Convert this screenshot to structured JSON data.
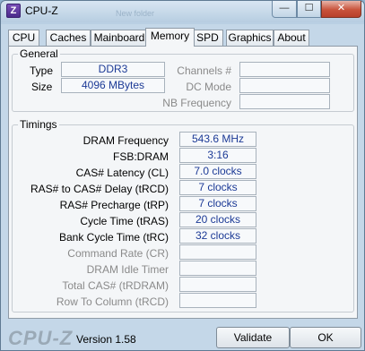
{
  "window": {
    "title": "CPU-Z",
    "app_icon_glyph": "Z",
    "background_text": "New folder"
  },
  "caption": {
    "minimize": "—",
    "maximize": "☐",
    "close": "✕"
  },
  "tabs": [
    {
      "label": "CPU"
    },
    {
      "label": "Caches"
    },
    {
      "label": "Mainboard"
    },
    {
      "label": "Memory"
    },
    {
      "label": "SPD"
    },
    {
      "label": "Graphics"
    },
    {
      "label": "About"
    }
  ],
  "active_tab": "Memory",
  "general": {
    "title": "General",
    "type_label": "Type",
    "type_value": "DDR3",
    "size_label": "Size",
    "size_value": "4096 MBytes",
    "channels_label": "Channels #",
    "channels_value": "",
    "dc_mode_label": "DC Mode",
    "dc_mode_value": "",
    "nb_frequency_label": "NB Frequency",
    "nb_frequency_value": ""
  },
  "timings": {
    "title": "Timings",
    "rows": [
      {
        "label": "DRAM Frequency",
        "value": "543.6 MHz"
      },
      {
        "label": "FSB:DRAM",
        "value": "3:16"
      },
      {
        "label": "CAS# Latency (CL)",
        "value": "7.0 clocks"
      },
      {
        "label": "RAS# to CAS# Delay (tRCD)",
        "value": "7 clocks"
      },
      {
        "label": "RAS# Precharge (tRP)",
        "value": "7 clocks"
      },
      {
        "label": "Cycle Time (tRAS)",
        "value": "20 clocks"
      },
      {
        "label": "Bank Cycle Time (tRC)",
        "value": "32 clocks"
      },
      {
        "label": "Command Rate (CR)",
        "value": ""
      },
      {
        "label": "DRAM Idle Timer",
        "value": ""
      },
      {
        "label": "Total CAS# (tRDRAM)",
        "value": ""
      },
      {
        "label": "Row To Column (tRCD)",
        "value": ""
      }
    ]
  },
  "footer": {
    "logo": "CPU-Z",
    "version": "Version 1.58",
    "validate_label": "Validate",
    "ok_label": "OK"
  }
}
